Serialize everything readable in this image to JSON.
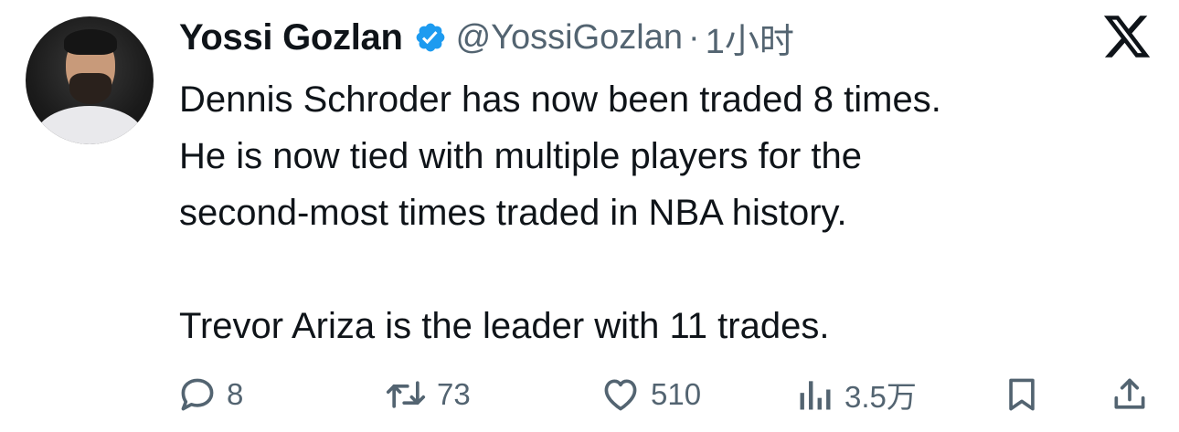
{
  "tweet": {
    "author": {
      "display_name": "Yossi Gozlan",
      "verified": true,
      "handle": "@YossiGozlan",
      "separator": "·",
      "time": "1小时"
    },
    "text_lines": [
      "Dennis Schroder has now been traded 8 times.",
      "He is now tied with multiple players for the",
      "second-most times traded in NBA history.",
      "",
      "Trevor Ariza is the leader with 11 trades."
    ],
    "stats": {
      "replies": "8",
      "retweets": "73",
      "likes": "510",
      "views": "3.5万"
    },
    "icons": {
      "logo": "x-logo-icon",
      "verified": "verified-badge-icon",
      "reply": "reply-icon",
      "retweet": "retweet-icon",
      "like": "heart-icon",
      "views": "views-icon",
      "bookmark": "bookmark-icon",
      "share": "share-icon"
    },
    "colors": {
      "verified_badge": "#1d9bf0",
      "text_primary": "#0f1419",
      "text_secondary": "#536471"
    }
  }
}
